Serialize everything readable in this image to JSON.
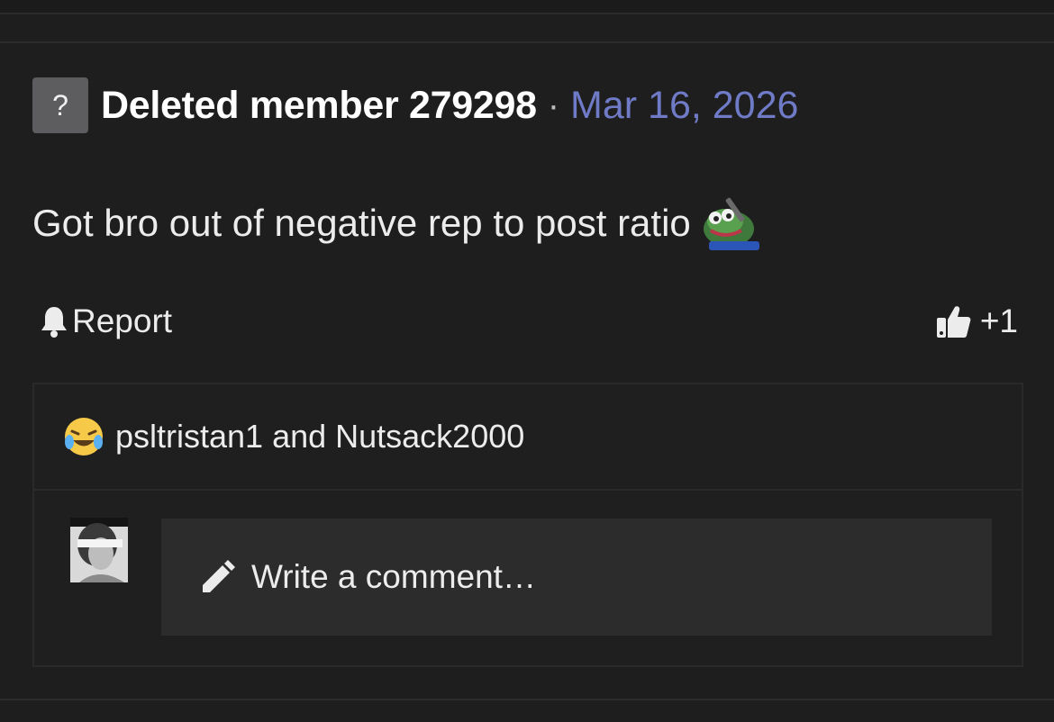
{
  "post": {
    "author_avatar_glyph": "?",
    "author": "Deleted member 279298",
    "separator": "·",
    "date": "Mar 16, 2026",
    "body": "Got bro out of negative rep to post ratio",
    "inline_emoji": "pepe-sticker"
  },
  "actions": {
    "report_label": "Report",
    "report_icon": "bell-icon",
    "like_icon": "thumbs-up-icon",
    "like_count": "+1"
  },
  "reactions": {
    "emoji": "crying-laughing-face",
    "summary": "psltristan1 and Nutsack2000"
  },
  "comment": {
    "placeholder": "Write a comment…",
    "icon": "pencil-icon"
  },
  "colors": {
    "background": "#1e1e1f",
    "date_link": "#6f7bc6",
    "input_bg": "#2c2c2d",
    "avatar_placeholder": "#5d5d5f"
  }
}
